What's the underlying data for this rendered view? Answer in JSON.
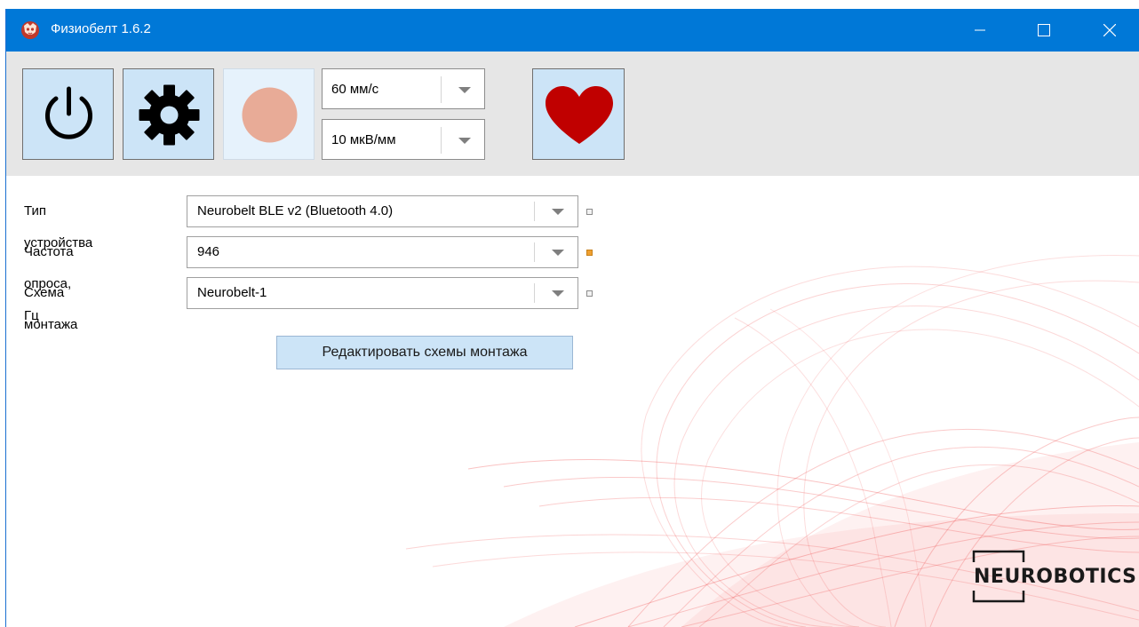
{
  "window": {
    "title": "Физиобелт 1.6.2",
    "controls": [
      "minimize-icon",
      "maximize-icon",
      "close-icon"
    ]
  },
  "toolbar": {
    "buttons": [
      {
        "name": "power-icon",
        "state": "active"
      },
      {
        "name": "gear-icon",
        "state": "active"
      },
      {
        "name": "record-icon",
        "state": "disabled",
        "color": "#e8ab97"
      },
      {
        "name": "heart-icon",
        "state": "active",
        "color": "#c00000"
      }
    ],
    "speed_select": {
      "value": "60 мм/с"
    },
    "gain_select": {
      "value": "10 мкВ/мм"
    }
  },
  "form": {
    "device_type": {
      "label": "Тип устройства",
      "value": "Neurobelt BLE v2 (Bluetooth 4.0)",
      "status": "neutral"
    },
    "sample_rate": {
      "label": "Частота опроса, Гц",
      "value": "946",
      "status": "warning",
      "status_color": "#f0a030"
    },
    "montage": {
      "label": "Схема монтажа",
      "value": "Neurobelt-1",
      "status": "neutral"
    },
    "edit_button": "Редактировать схемы монтажа"
  },
  "branding": {
    "logo_text": "NEUROBOTICS",
    "accent": "#0078d7",
    "art_color": "#f05050"
  }
}
